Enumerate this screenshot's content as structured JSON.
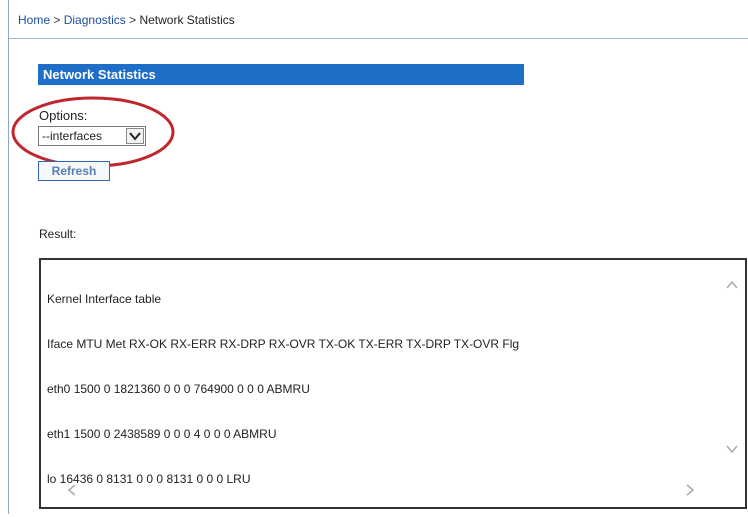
{
  "breadcrumb": {
    "home": "Home",
    "sep1": ">",
    "diagnostics": "Diagnostics",
    "sep2": ">",
    "current": "Network Statistics"
  },
  "section": {
    "title": "Network Statistics"
  },
  "options": {
    "label": "Options:",
    "selected": "--interfaces"
  },
  "refresh": {
    "label": "Refresh"
  },
  "result": {
    "label": "Result:",
    "lines": [
      "Kernel Interface table",
      "Iface MTU Met RX-OK RX-ERR RX-DRP RX-OVR TX-OK TX-ERR TX-DRP TX-OVR Flg",
      "eth0 1500 0 1821360 0 0 0 764900 0 0 0 ABMRU",
      "eth1 1500 0 2438589 0 0 0 4 0 0 0 ABMRU",
      "lo 16436 0 8131 0 0 0 8131 0 0 0 LRU"
    ]
  },
  "colors": {
    "header_bg": "#1e6ec8",
    "link": "#1b4fa0",
    "highlight_ring": "#c0272d"
  }
}
